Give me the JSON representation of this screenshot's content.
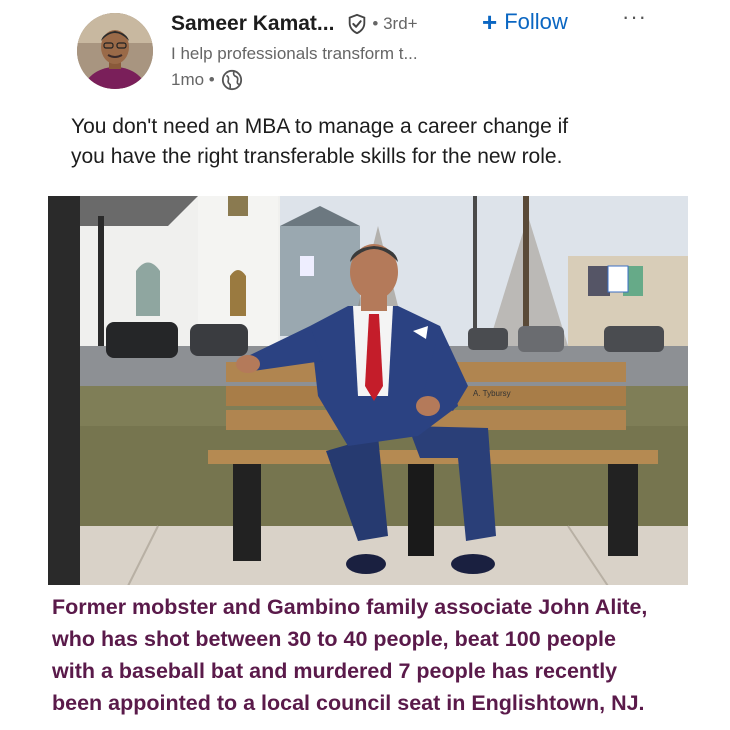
{
  "author": {
    "name": "Sameer Kamat...",
    "degree": "• 3rd+",
    "headline": "I help professionals transform t...",
    "time": "1mo •"
  },
  "actions": {
    "follow_label": "Follow",
    "more_label": "···"
  },
  "icons": {
    "verified": "shield-check-icon",
    "globe": "globe-icon",
    "follow": "plus-icon"
  },
  "colors": {
    "link": "#0a66c2",
    "caption_text": "#5a1a4a"
  },
  "post": {
    "text_lines": [
      "You don't need an MBA to manage a career change if",
      "you have  the right transferable skills for the new role."
    ]
  },
  "image": {
    "sign_text": "A. Tybursy",
    "caption_lines": [
      "Former mobster and Gambino family associate John Alite,",
      "who has shot between 30 to 40 people, beat 100 people",
      "with a baseball bat and murdered 7 people has recently",
      "been appointed to a local council seat in Englishtown, NJ."
    ]
  }
}
